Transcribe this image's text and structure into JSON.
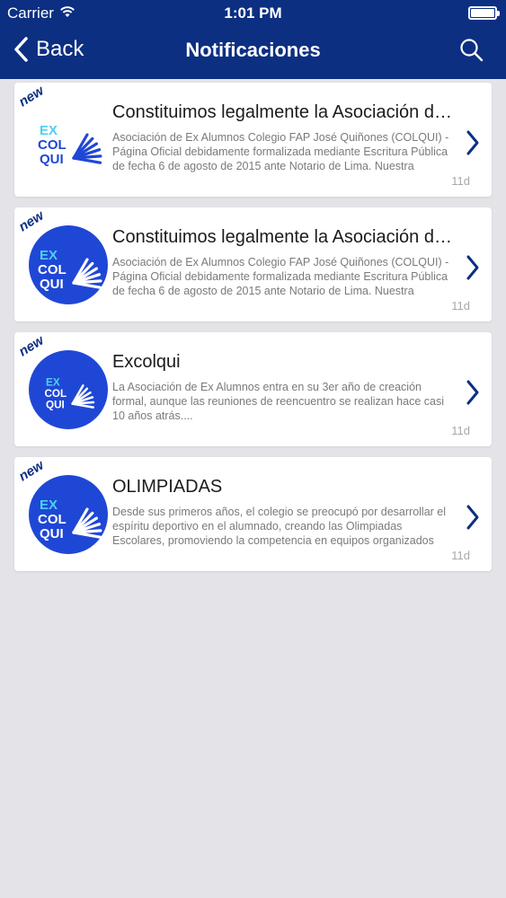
{
  "status_bar": {
    "carrier": "Carrier",
    "time": "1:01 PM"
  },
  "nav": {
    "back_label": "Back",
    "title": "Notificaciones"
  },
  "colors": {
    "nav_bg": "#0c2f82",
    "logo_blue": "#1f47d6",
    "logo_cyan": "#4fd0f0",
    "background": "#e4e3e8"
  },
  "logo_text": {
    "ex": "EX",
    "col": "COL",
    "qui": "QUI"
  },
  "notifications": [
    {
      "badge": "new",
      "title": "Constituimos legalmente la Asociación de Ex Alumnos",
      "description": "Asociación de Ex Alumnos Colegio FAP José Quiñones (COLQUI) - Página Oficial debidamente formalizada mediante Escritura Pública de fecha 6 de agosto de 2015 ante Notario de Lima. Nuestra",
      "age": "11d",
      "logo_style": "plain"
    },
    {
      "badge": "new",
      "title": "Constituimos legalmente la Asociación de Ex Alumnos",
      "description": "Asociación de Ex Alumnos Colegio FAP José Quiñones (COLQUI) - Página Oficial debidamente formalizada mediante Escritura Pública de fecha 6 de agosto de 2015 ante Notario de Lima. Nuestra",
      "age": "11d",
      "logo_style": "circle"
    },
    {
      "badge": "new",
      "title": "Excolqui",
      "description": "La Asociación de Ex Alumnos entra en su 3er año de creación formal, aunque las reuniones de reencuentro se realizan hace casi 10 años atrás....",
      "age": "11d",
      "logo_style": "circle-small"
    },
    {
      "badge": "new",
      "title": "OLIMPIADAS",
      "description": "Desde sus primeros años, el colegio se preocupó por desarrollar el espíritu deportivo en el alumnado, creando las Olimpiadas Escolares, promoviendo la competencia en equipos organizados",
      "age": "11d",
      "logo_style": "circle"
    }
  ]
}
